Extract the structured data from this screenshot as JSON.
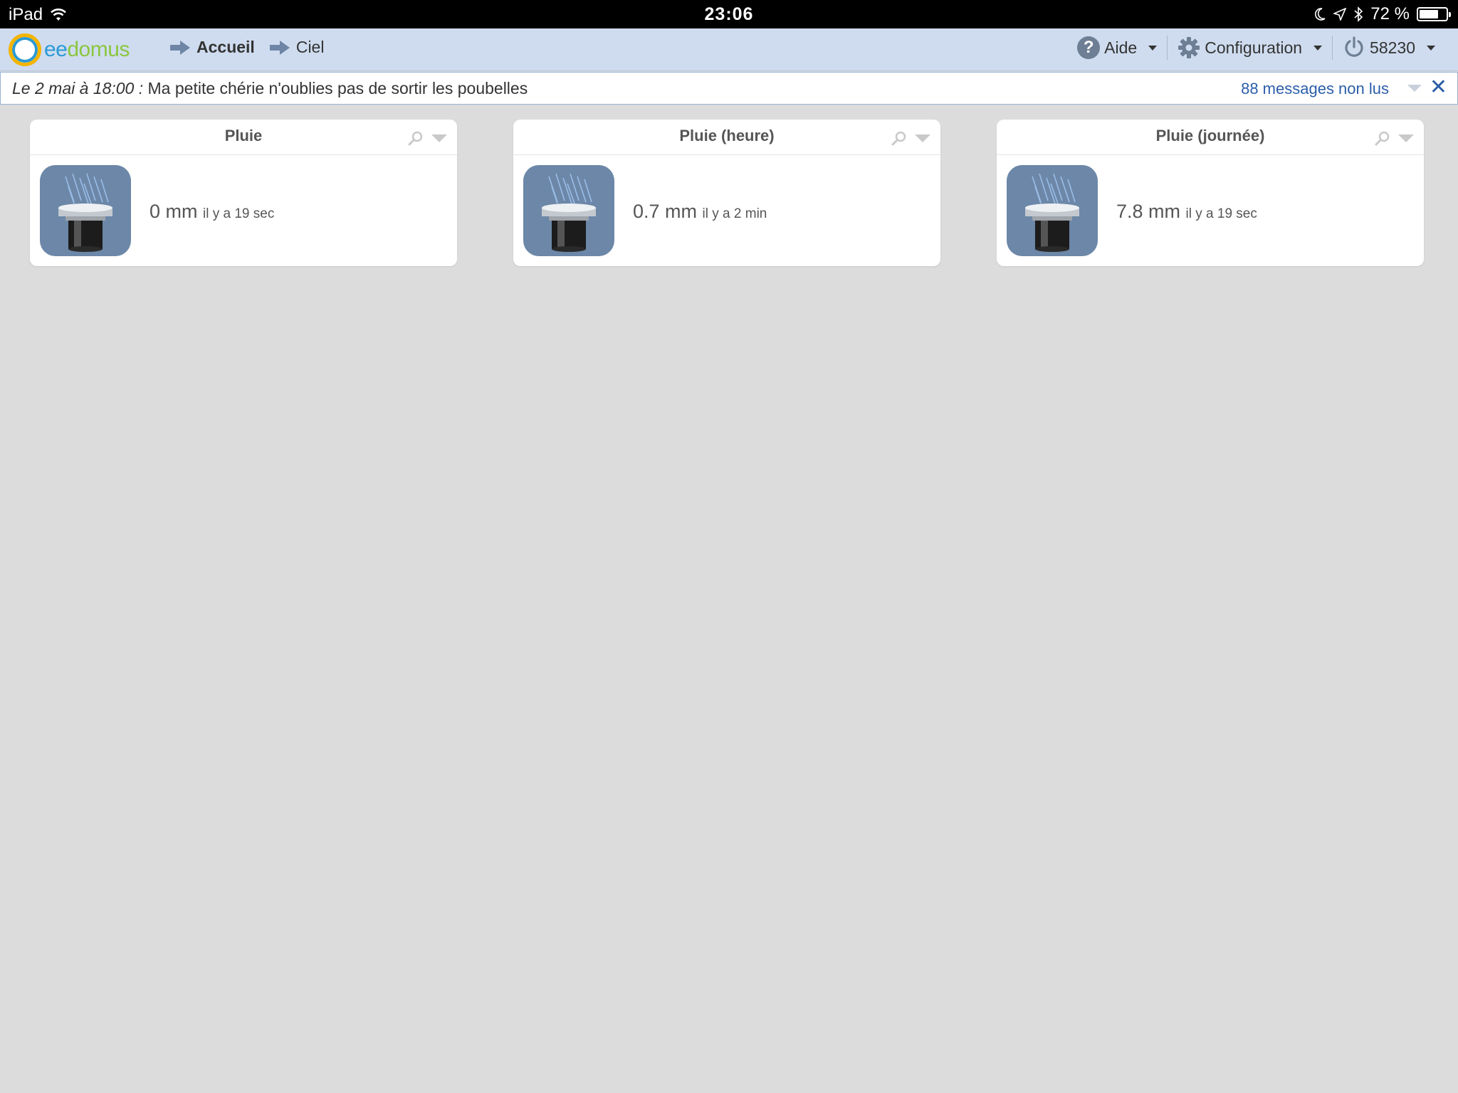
{
  "statusbar": {
    "device": "iPad",
    "time": "23:06",
    "battery": "72 %",
    "battery_level": 0.72
  },
  "app": {
    "logo_text_part1": "ee",
    "logo_text_part2": "domus"
  },
  "nav": {
    "items": [
      {
        "label": "Accueil",
        "active": true
      },
      {
        "label": "Ciel",
        "active": false
      }
    ]
  },
  "topright": {
    "help_label": "Aide",
    "config_label": "Configuration",
    "box_id": "58230"
  },
  "messages": {
    "date": "Le 2 mai à 18:00 :",
    "text": "Ma petite chérie n'oublies pas de sortir les poubelles",
    "unread": "88 messages non lus"
  },
  "widgets": [
    {
      "title": "Pluie",
      "value": "0 mm",
      "ago": "il y a 19 sec"
    },
    {
      "title": "Pluie (heure)",
      "value": "0.7 mm",
      "ago": "il y a 2 min"
    },
    {
      "title": "Pluie (journée)",
      "value": "7.8 mm",
      "ago": "il y a 19 sec"
    }
  ],
  "colors": {
    "topbar": "#cfdcef",
    "accent_link": "#2b5ea8",
    "background": "#dcdcdc",
    "icon_bg": "#6c87a8"
  },
  "icons": [
    "wifi-icon",
    "moon-icon",
    "location-icon",
    "bluetooth-icon",
    "battery-icon",
    "arrow-right-icon",
    "help-icon",
    "gear-icon",
    "power-icon",
    "search-icon",
    "rain-gauge-icon",
    "close-icon"
  ]
}
